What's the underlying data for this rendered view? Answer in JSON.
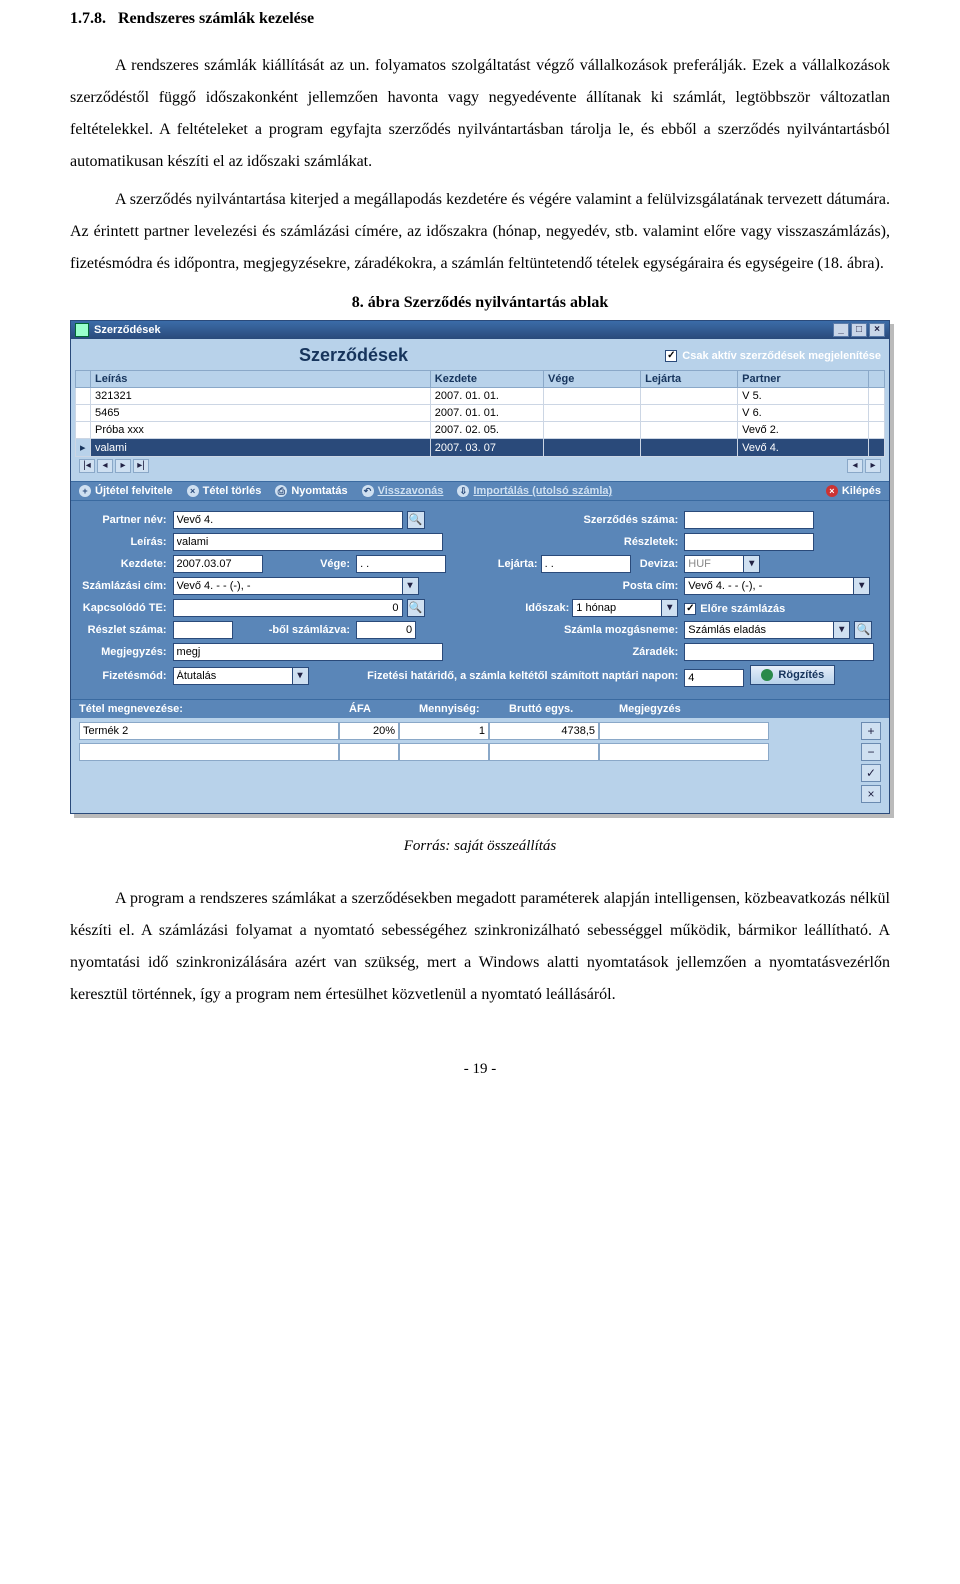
{
  "doc": {
    "heading_no": "1.7.8.",
    "heading_text": "Rendszeres számlák kezelése",
    "para1": "A rendszeres számlák kiállítását az un. folyamatos szolgáltatást végző vállalkozások preferálják. Ezek a vállalkozások szerződéstől függő időszakonként jellemzően havonta vagy negyedévente állítanak ki számlát, legtöbbször változatlan feltételekkel. A feltételeket a program egyfajta szerződés nyilvántartásban tárolja le, és ebből a szerződés nyilvántartásból automatikusan készíti el az időszaki számlákat.",
    "para2": "A szerződés nyilvántartása kiterjed a megállapodás kezdetére és végére valamint a felülvizsgálatának tervezett dátumára. Az érintett partner levelezési és számlázási címére, az időszakra (hónap, negyedév, stb. valamint előre vagy visszaszámlázás), fizetésmódra és időpontra, megjegyzésekre, záradékokra, a számlán feltüntetendő tételek egységáraira és egységeire (18. ábra).",
    "caption": "8. ábra Szerződés nyilvántartás ablak",
    "source": "Forrás: saját összeállítás",
    "para3": "A program a rendszeres számlákat a szerződésekben megadott paraméterek alapján intelligensen, közbeavatkozás nélkül készíti el. A számlázási folyamat a nyomtató sebességéhez szinkronizálható sebességgel működik, bármikor leállítható. A nyomtatási idő szinkronizálására azért van szükség, mert a Windows alatti nyomtatások jellemzően a nyomtatásvezérlőn keresztül történnek, így a program nem értesülhet közvetlenül a nyomtató leállásáról.",
    "pagenum": "- 19 -"
  },
  "win": {
    "title": "Szerződések",
    "big_title": "Szerződések",
    "active_only": "Csak aktív szerződések megjelenítése",
    "cols": {
      "leiras": "Leírás",
      "kezdete": "Kezdete",
      "vege": "Vége",
      "lejarta": "Lejárta",
      "partner": "Partner"
    },
    "rows": [
      {
        "leiras": "321321",
        "kezdete": "2007. 01. 01.",
        "vege": "",
        "lejarta": "",
        "partner": "V 5."
      },
      {
        "leiras": "5465",
        "kezdete": "2007. 01. 01.",
        "vege": "",
        "lejarta": "",
        "partner": "V 6."
      },
      {
        "leiras": "Próba xxx",
        "kezdete": "2007. 02. 05.",
        "vege": "",
        "lejarta": "",
        "partner": "Vevő 2."
      },
      {
        "leiras": "valami",
        "kezdete": "2007. 03. 07",
        "vege": "",
        "lejarta": "",
        "partner": "Vevő 4."
      }
    ],
    "toolbar": {
      "new": "Újtétel felvitele",
      "del": "Tétel törlés",
      "print": "Nyomtatás",
      "undo": "Visszavonás",
      "import": "Importálás (utolsó számla)",
      "exit": "Kilépés"
    },
    "form": {
      "partner_lbl": "Partner név:",
      "partner_val": "Vevő 4.",
      "szerz_lbl": "Szerződés száma:",
      "leiras_lbl": "Leírás:",
      "leiras_val": "valami",
      "reszletek_lbl": "Részletek:",
      "kezdete_lbl": "Kezdete:",
      "kezdete_val": "2007.03.07",
      "vege_lbl": "Vége:",
      "vege_val": ". .",
      "lejarta_lbl": "Lejárta:",
      "lejarta_val": ". .",
      "deviza_lbl": "Deviza:",
      "deviza_val": "HUF",
      "szamcim_lbl": "Számlázási cím:",
      "szamcim_val": "Vevő 4. - - (-), -",
      "postacim_lbl": "Posta cím:",
      "postacim_val": "Vevő 4. - - (-), -",
      "kapT_lbl": "Kapcsolódó TE:",
      "kapT_val": "0",
      "idoszak_lbl": "Időszak:",
      "idoszak_val": "1 hónap",
      "elore_lbl": "Előre számlázás",
      "reszletszama_lbl": "Részlet száma:",
      "bolszaml_lbl": "-ből számlázva:",
      "bolszaml_val": "0",
      "mozgasnem_lbl": "Számla mozgásneme:",
      "mozgasnem_val": "Számlás eladás",
      "megj_lbl": "Megjegyzés:",
      "megj_val": "megj",
      "zaradek_lbl": "Záradék:",
      "fizmod_lbl": "Fizetésmód:",
      "fizmod_val": "Átutalás",
      "fizhat_lbl": "Fizetési határidő, a számla keltétől számított naptári napon:",
      "fizhat_val": "4",
      "rogz_btn": "Rögzítés"
    },
    "items": {
      "h_tetel": "Tétel megnevezése:",
      "h_afa": "ÁFA",
      "h_menny": "Mennyiség:",
      "h_brutto": "Bruttó egys.",
      "h_megj": "Megjegyzés",
      "r_tetel": "Termék 2",
      "r_afa": "20%",
      "r_menny": "1",
      "r_brutto": "4738,5",
      "r_megj": ""
    }
  }
}
